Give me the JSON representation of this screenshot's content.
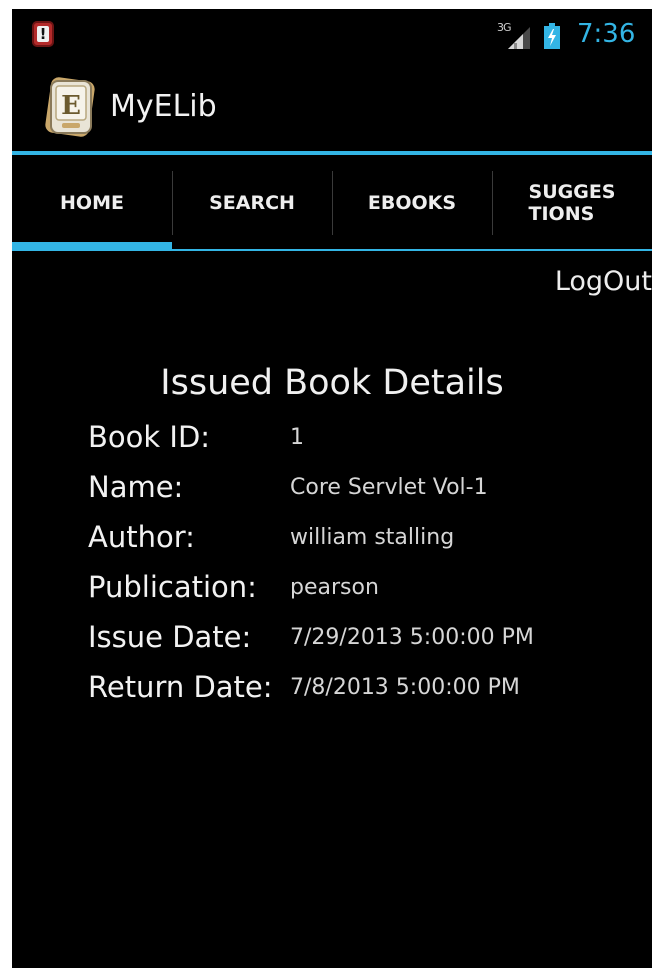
{
  "status_bar": {
    "network_type": "3G",
    "time": "7:36",
    "notification_glyph": "!",
    "icons": [
      "alert-notification-icon",
      "signal-icon",
      "battery-charging-icon"
    ],
    "clock_color": "#33b5e5"
  },
  "action_bar": {
    "app_title": "MyELib",
    "logo_icon": "ebook-logo-icon",
    "logo_letter": "E",
    "accent_color": "#33b5e5"
  },
  "tabs": [
    {
      "label": "HOME",
      "active": true
    },
    {
      "label": "SEARCH",
      "active": false
    },
    {
      "label": "EBOOKS",
      "active": false
    },
    {
      "label": "SUGGES\nTIONS",
      "active": false
    }
  ],
  "logout_label": "LogOut",
  "details": {
    "title": "Issued Book Details",
    "rows": [
      {
        "label": "Book ID:",
        "value": "1"
      },
      {
        "label": "Name:",
        "value": "Core Servlet Vol-1"
      },
      {
        "label": "Author:",
        "value": "william stalling"
      },
      {
        "label": "Publication:",
        "value": "pearson"
      },
      {
        "label": "Issue Date:",
        "value": "7/29/2013 5:00:00 PM"
      },
      {
        "label": "Return Date:",
        "value": "7/8/2013 5:00:00 PM"
      }
    ]
  }
}
